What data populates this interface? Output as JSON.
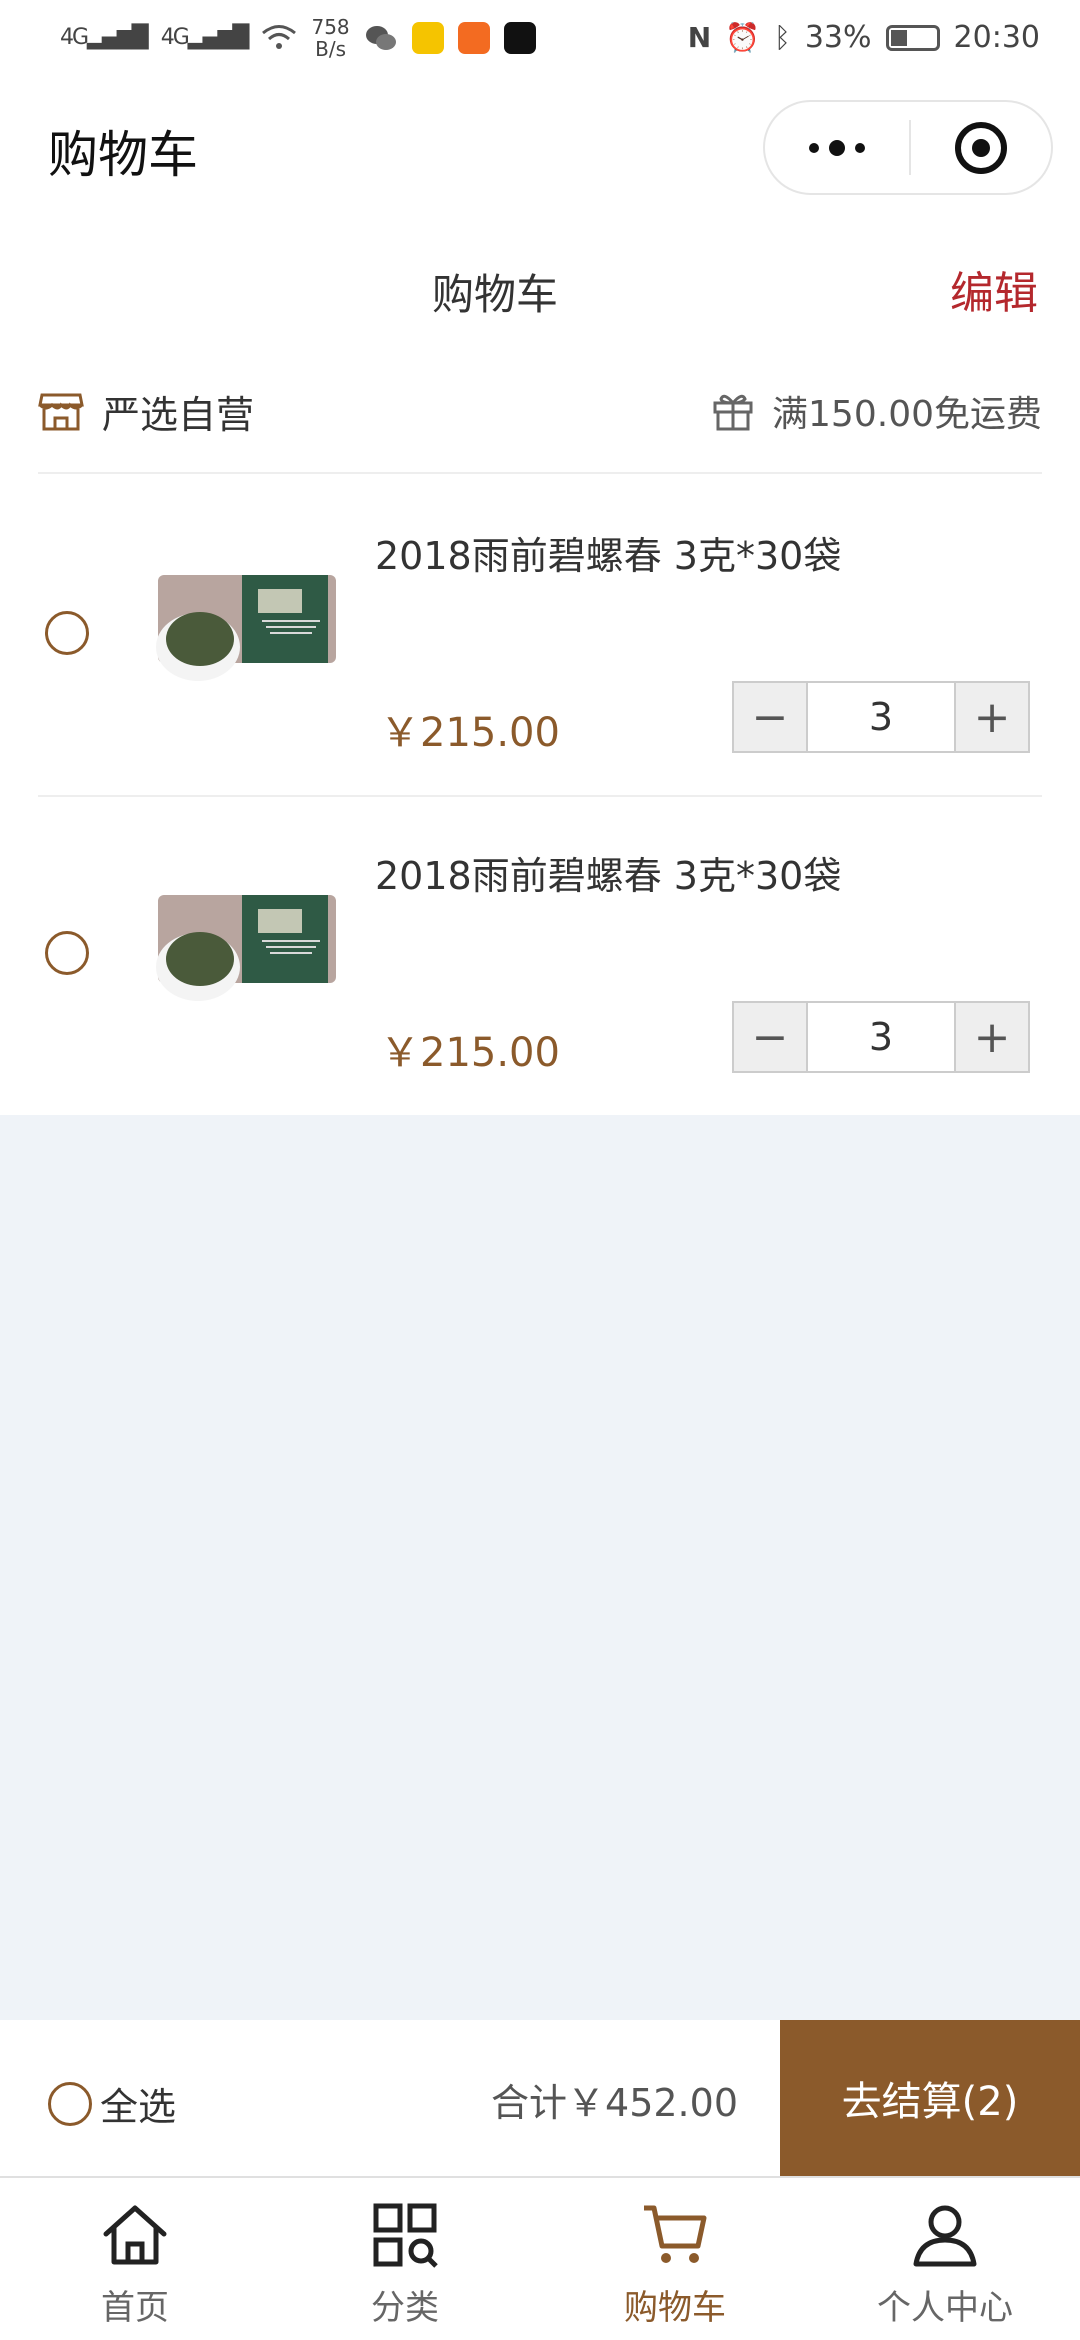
{
  "status_bar": {
    "network": "4G",
    "speed_value": "758",
    "speed_unit": "B/s",
    "battery": "33%",
    "time": "20:30"
  },
  "nav": {
    "title": "购物车"
  },
  "header": {
    "title": "购物车",
    "edit_label": "编辑"
  },
  "store": {
    "name": "严选自营",
    "free_shipping": "满150.00免运费"
  },
  "items": [
    {
      "name": "2018雨前碧螺春 3克*30袋",
      "price": "￥215.00",
      "quantity": "3"
    },
    {
      "name": "2018雨前碧螺春 3克*30袋",
      "price": "￥215.00",
      "quantity": "3"
    }
  ],
  "stepper": {
    "minus": "−",
    "plus": "+"
  },
  "checkout": {
    "select_all": "全选",
    "total": "合计￥452.00",
    "button": "去结算(2)"
  },
  "tabs": [
    {
      "label": "首页",
      "icon": "home-icon"
    },
    {
      "label": "分类",
      "icon": "category-icon"
    },
    {
      "label": "购物车",
      "icon": "cart-icon"
    },
    {
      "label": "个人中心",
      "icon": "user-icon"
    }
  ],
  "colors": {
    "accent": "#8b5a2b",
    "edit": "#b4282d",
    "background": "#eff3f8"
  }
}
